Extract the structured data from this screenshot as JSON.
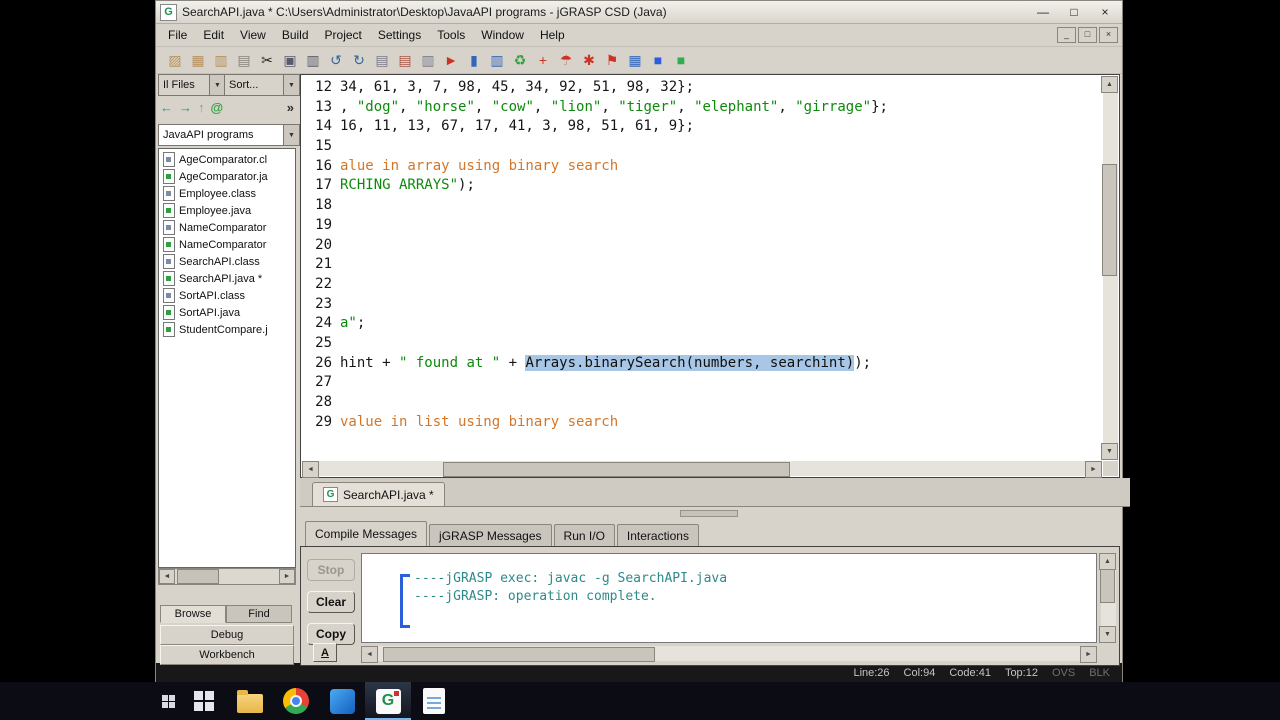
{
  "window": {
    "title": "SearchAPI.java * C:\\Users\\Administrator\\Desktop\\JavaAPI programs - jGRASP CSD (Java)",
    "app_icon": "G",
    "controls": {
      "minimize": "—",
      "maximize": "□",
      "close": "×"
    },
    "mdi_controls": {
      "minimize": "_",
      "restore": "□",
      "close": "×"
    }
  },
  "glyphs": {
    "up": "▲",
    "down": "▼",
    "left": "◄",
    "right": "►",
    "dd": "▼"
  },
  "menu": {
    "items": [
      "File",
      "Edit",
      "View",
      "Build",
      "Project",
      "Settings",
      "Tools",
      "Window",
      "Help"
    ]
  },
  "toolbar": {
    "icons": [
      {
        "name": "open-file-icon",
        "glyph": "▨",
        "color": "#b8905c"
      },
      {
        "name": "save-file-icon",
        "glyph": "▦",
        "color": "#b8905c"
      },
      {
        "name": "save-all-icon",
        "glyph": "▥",
        "color": "#b8905c"
      },
      {
        "name": "print-icon",
        "glyph": "▤",
        "color": "#88847c"
      },
      {
        "name": "cut-icon",
        "glyph": "✂",
        "color": "#262626"
      },
      {
        "name": "copy-icon",
        "glyph": "▣",
        "color": "#5a5a6a"
      },
      {
        "name": "paste-icon",
        "glyph": "▥",
        "color": "#5a5a6a"
      },
      {
        "name": "undo-icon",
        "glyph": "↺",
        "color": "#336699"
      },
      {
        "name": "redo-icon",
        "glyph": "↻",
        "color": "#336699"
      },
      {
        "name": "csd-generate-icon",
        "glyph": "▤",
        "color": "#7a7a8a"
      },
      {
        "name": "csd-remove-icon",
        "glyph": "▤",
        "color": "#aa5544"
      },
      {
        "name": "number-lines-icon",
        "glyph": "▥",
        "color": "#7a7a8a"
      },
      {
        "name": "compile-dart-icon",
        "glyph": "►",
        "color": "#cc3322"
      },
      {
        "name": "chart-icon",
        "glyph": "▮",
        "color": "#3366bb"
      },
      {
        "name": "structure-icon",
        "glyph": "▥",
        "color": "#3366bb"
      },
      {
        "name": "sync-icon",
        "glyph": "♻",
        "color": "#2f9f3f"
      },
      {
        "name": "add-icon",
        "glyph": "+",
        "color": "#cc3322"
      },
      {
        "name": "umbrella-icon",
        "glyph": "☂",
        "color": "#cc3322"
      },
      {
        "name": "debug-ant-icon",
        "glyph": "✱",
        "color": "#cc3322"
      },
      {
        "name": "pin-icon",
        "glyph": "⚑",
        "color": "#cc3322"
      },
      {
        "name": "grid-icon",
        "glyph": "▦",
        "color": "#3366bb"
      },
      {
        "name": "stop-blue-icon",
        "glyph": "■",
        "color": "#2b5fd9"
      },
      {
        "name": "run-green-icon",
        "glyph": "■",
        "color": "#2fae4e"
      }
    ]
  },
  "sidebar": {
    "files_filter": "Il Files",
    "sort_label": "Sort...",
    "project": "JavaAPI programs",
    "nav": [
      {
        "name": "back-icon",
        "glyph": "←",
        "color": "#2a8f8f"
      },
      {
        "name": "forward-icon",
        "glyph": "→",
        "color": "#2a8f8f"
      },
      {
        "name": "up-folder-icon",
        "glyph": "↑",
        "color": "#b8905c"
      },
      {
        "name": "refresh-icon",
        "glyph": "@",
        "color": "#2f9f3f"
      },
      {
        "name": "more-icon",
        "glyph": "»",
        "color": "#303030"
      }
    ],
    "files": [
      {
        "label": "AgeComparator.cl",
        "type": "class"
      },
      {
        "label": "AgeComparator.ja",
        "type": "java"
      },
      {
        "label": "Employee.class",
        "type": "class"
      },
      {
        "label": "Employee.java",
        "type": "java"
      },
      {
        "label": "NameComparator",
        "type": "class"
      },
      {
        "label": "NameComparator",
        "type": "java"
      },
      {
        "label": "SearchAPI.class",
        "type": "class"
      },
      {
        "label": "SearchAPI.java *",
        "type": "java"
      },
      {
        "label": "SortAPI.class",
        "type": "class"
      },
      {
        "label": "SortAPI.java",
        "type": "java"
      },
      {
        "label": "StudentCompare.j",
        "type": "java"
      }
    ],
    "tabs": [
      {
        "label": "Browse",
        "active": true
      },
      {
        "label": "Find",
        "active": false
      }
    ],
    "buttons": [
      "Debug",
      "Workbench"
    ]
  },
  "editor": {
    "lines": [
      {
        "n": "12",
        "segs": [
          {
            "t": "34, 61, 3, 7, 98, 45, 34, 92, 51, 98, 32};",
            "c": "plain"
          }
        ]
      },
      {
        "n": "13",
        "segs": [
          {
            "t": ", ",
            "c": "plain"
          },
          {
            "t": "\"dog\"",
            "c": "str"
          },
          {
            "t": ", ",
            "c": "plain"
          },
          {
            "t": "\"horse\"",
            "c": "str"
          },
          {
            "t": ", ",
            "c": "plain"
          },
          {
            "t": "\"cow\"",
            "c": "str"
          },
          {
            "t": ", ",
            "c": "plain"
          },
          {
            "t": "\"lion\"",
            "c": "str"
          },
          {
            "t": ", ",
            "c": "plain"
          },
          {
            "t": "\"tiger\"",
            "c": "str"
          },
          {
            "t": ", ",
            "c": "plain"
          },
          {
            "t": "\"elephant\"",
            "c": "str"
          },
          {
            "t": ", ",
            "c": "plain"
          },
          {
            "t": "\"girrage\"",
            "c": "str"
          },
          {
            "t": "};",
            "c": "plain"
          }
        ]
      },
      {
        "n": "14",
        "segs": [
          {
            "t": "16, 11, 13, 67, 17, 41, 3, 98, 51, 61, 9};",
            "c": "plain"
          }
        ]
      },
      {
        "n": "15",
        "segs": []
      },
      {
        "n": "16",
        "segs": [
          {
            "t": "alue in array using binary search",
            "c": "com"
          }
        ]
      },
      {
        "n": "17",
        "segs": [
          {
            "t": "RCHING ARRAYS\"",
            "c": "str"
          },
          {
            "t": ");",
            "c": "plain"
          }
        ]
      },
      {
        "n": "18",
        "segs": []
      },
      {
        "n": "19",
        "segs": []
      },
      {
        "n": "20",
        "segs": []
      },
      {
        "n": "21",
        "segs": []
      },
      {
        "n": "22",
        "segs": []
      },
      {
        "n": "23",
        "segs": []
      },
      {
        "n": "24",
        "segs": [
          {
            "t": "a\"",
            "c": "str"
          },
          {
            "t": ";",
            "c": "plain"
          }
        ]
      },
      {
        "n": "25",
        "segs": []
      },
      {
        "n": "26",
        "segs": [
          {
            "t": "hint + ",
            "c": "plain"
          },
          {
            "t": "\" found at \"",
            "c": "str"
          },
          {
            "t": " + ",
            "c": "plain"
          },
          {
            "t": "Arrays.binarySearch(numbers, searchint)",
            "c": "sel"
          },
          {
            "t": ");",
            "c": "plain"
          }
        ]
      },
      {
        "n": "27",
        "segs": []
      },
      {
        "n": "28",
        "segs": []
      },
      {
        "n": "29",
        "segs": [
          {
            "t": "value in list using binary search",
            "c": "com"
          }
        ]
      }
    ]
  },
  "file_tabs": [
    {
      "label": "SearchAPI.java *",
      "icon": "G",
      "active": true
    }
  ],
  "bottom": {
    "tabs": [
      {
        "label": "Compile Messages",
        "active": true
      },
      {
        "label": "jGRASP Messages",
        "active": false
      },
      {
        "label": "Run I/O",
        "active": false
      },
      {
        "label": "Interactions",
        "active": false
      }
    ],
    "buttons": [
      {
        "label": "Stop",
        "disabled": true
      },
      {
        "label": "Clear",
        "disabled": false
      },
      {
        "label": "Copy",
        "disabled": false
      }
    ],
    "font_button": "A",
    "messages": [
      "----jGRASP exec: javac -g SearchAPI.java",
      "",
      "----jGRASP: operation complete."
    ]
  },
  "status": {
    "items": [
      "Line:26",
      "Col:94",
      "Code:41",
      "Top:12"
    ],
    "modes": [
      "OVS",
      "BLK"
    ]
  },
  "taskbar": {
    "icons": [
      {
        "name": "task-view-icon",
        "icon": "grid",
        "active": false
      },
      {
        "name": "start-button",
        "icon": "start",
        "active": false
      },
      {
        "name": "file-explorer-icon",
        "icon": "folder",
        "active": false
      },
      {
        "name": "chrome-icon",
        "icon": "chrome",
        "active": false
      },
      {
        "name": "app-blue-icon",
        "icon": "blue",
        "active": false
      },
      {
        "name": "jgrasp-taskbar-icon",
        "icon": "jgrasp",
        "label": "G",
        "active": true
      },
      {
        "name": "document-app-icon",
        "icon": "doc",
        "active": false
      }
    ]
  }
}
